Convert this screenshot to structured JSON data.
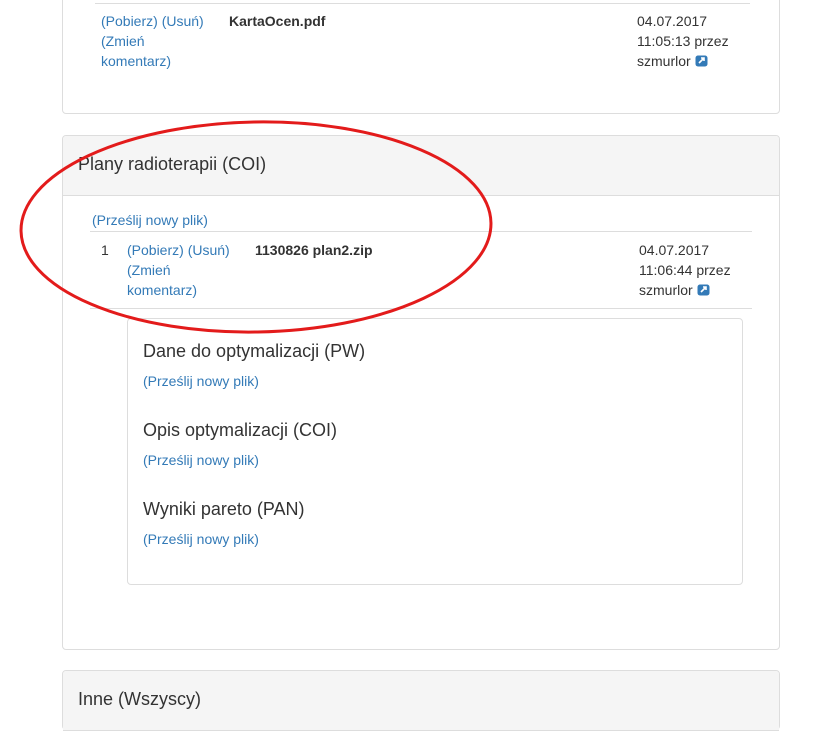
{
  "top_panel": {
    "file_row": {
      "download": "(Pobierz)",
      "delete": "(Usuń)",
      "change_comment_1": "(Zmień",
      "change_comment_2": "komentarz)",
      "filename": "KartaOcen.pdf",
      "date": "04.07.2017",
      "time_by": "11:05:13 przez",
      "user": "szmurlor"
    }
  },
  "radio_panel": {
    "title": "Plany radioterapii (COI)",
    "upload_link": "(Prześlij nowy plik)",
    "file_row": {
      "index": "1",
      "download": "(Pobierz)",
      "delete": "(Usuń)",
      "change_comment_1": "(Zmień",
      "change_comment_2": "komentarz)",
      "filename": "1130826 plan2.zip",
      "date": "04.07.2017",
      "time_by": "11:06:44 przez",
      "user": "szmurlor"
    },
    "sub_sections": [
      {
        "title": "Dane do optymalizacji (PW)",
        "upload_link": "(Prześlij nowy plik)"
      },
      {
        "title": "Opis optymalizacji (COI)",
        "upload_link": "(Prześlij nowy plik)"
      },
      {
        "title": "Wyniki pareto (PAN)",
        "upload_link": "(Prześlij nowy plik)"
      }
    ]
  },
  "bottom_panel": {
    "title": "Inne (Wszyscy)"
  },
  "icons": {
    "external_link": "external-link-icon"
  },
  "colors": {
    "link": "#337ab7",
    "annotation_ellipse": "#e31b1b",
    "panel_border": "#dddddd",
    "panel_heading_bg": "#f5f5f5"
  }
}
